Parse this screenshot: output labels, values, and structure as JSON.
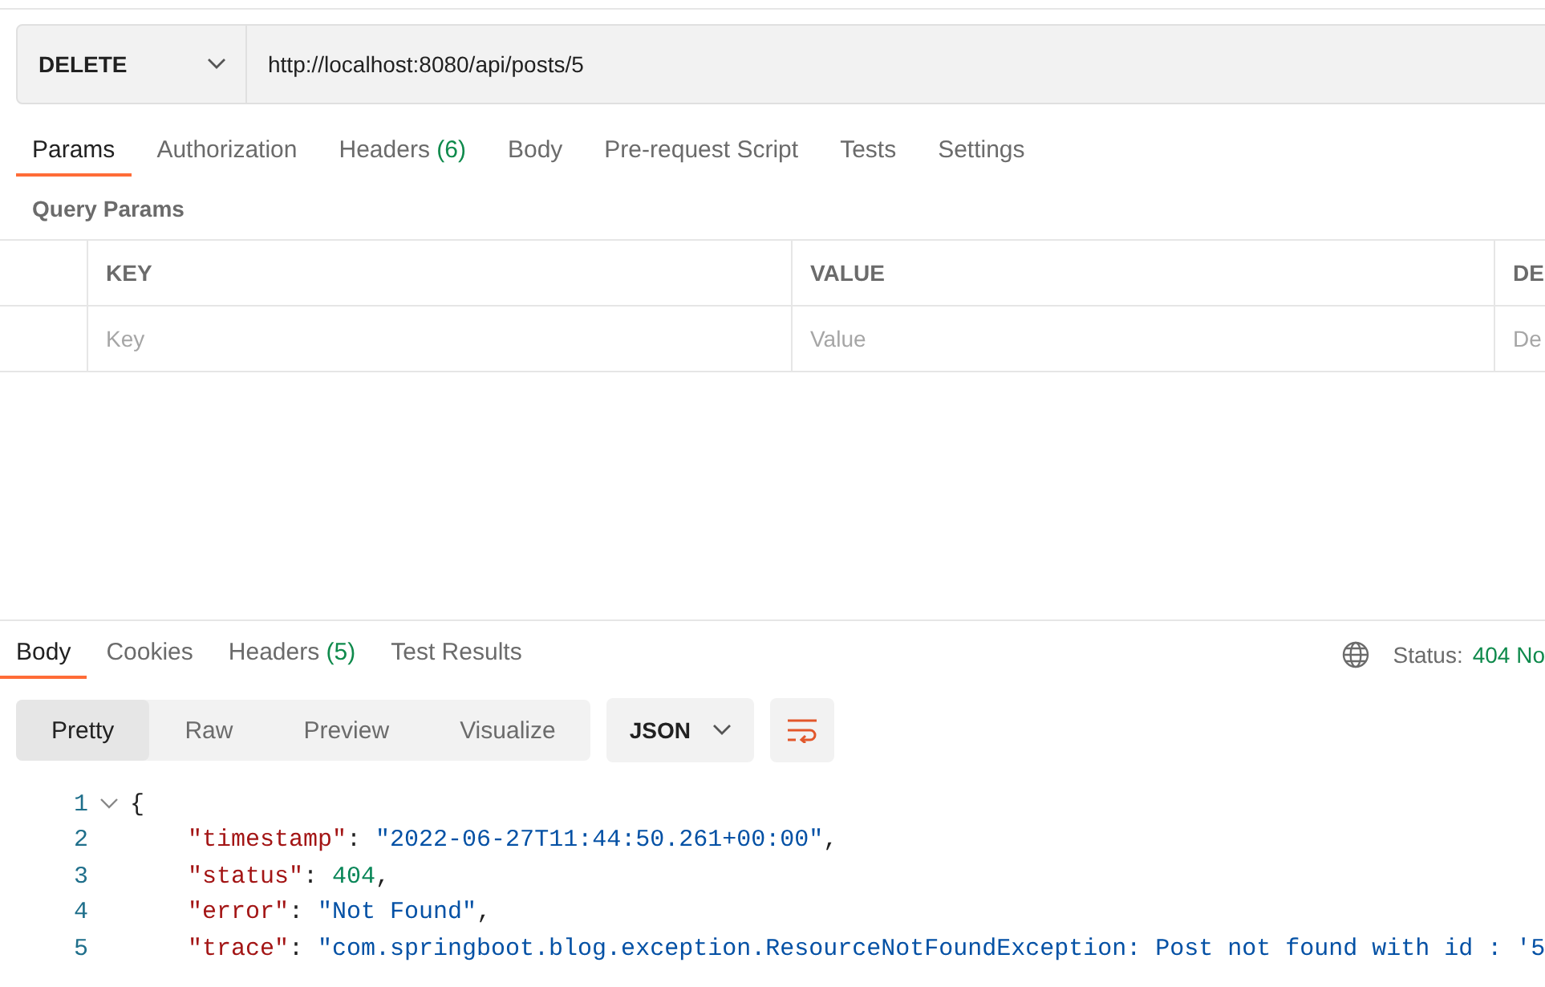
{
  "request": {
    "method": "DELETE",
    "url": "http://localhost:8080/api/posts/5"
  },
  "request_tabs": [
    {
      "label": "Params",
      "selected": true
    },
    {
      "label": "Authorization",
      "selected": false
    },
    {
      "label": "Headers",
      "count": "(6)",
      "selected": false
    },
    {
      "label": "Body",
      "selected": false
    },
    {
      "label": "Pre-request Script",
      "selected": false
    },
    {
      "label": "Tests",
      "selected": false
    },
    {
      "label": "Settings",
      "selected": false
    }
  ],
  "query_params": {
    "title": "Query Params",
    "columns": [
      "KEY",
      "VALUE",
      "DE"
    ],
    "placeholders": [
      "Key",
      "Value",
      "De"
    ]
  },
  "response_tabs": [
    {
      "label": "Body",
      "selected": true
    },
    {
      "label": "Cookies",
      "selected": false
    },
    {
      "label": "Headers",
      "count": "(5)",
      "selected": false
    },
    {
      "label": "Test Results",
      "selected": false
    }
  ],
  "status": {
    "label": "Status:",
    "value": "404 No"
  },
  "view_modes": [
    {
      "label": "Pretty",
      "selected": true
    },
    {
      "label": "Raw",
      "selected": false
    },
    {
      "label": "Preview",
      "selected": false
    },
    {
      "label": "Visualize",
      "selected": false
    }
  ],
  "format": "JSON",
  "code_lines": [
    {
      "number": "1",
      "foldable": true,
      "tokens": [
        {
          "kind": "punct",
          "text": "{"
        }
      ]
    },
    {
      "number": "2",
      "foldable": false,
      "tokens": [
        {
          "kind": "key",
          "text": "\"timestamp\""
        },
        {
          "kind": "punct",
          "text": ": "
        },
        {
          "kind": "string",
          "text": "\"2022-06-27T11:44:50.261+00:00\""
        },
        {
          "kind": "punct",
          "text": ","
        }
      ]
    },
    {
      "number": "3",
      "foldable": false,
      "tokens": [
        {
          "kind": "key",
          "text": "\"status\""
        },
        {
          "kind": "punct",
          "text": ": "
        },
        {
          "kind": "number",
          "text": "404"
        },
        {
          "kind": "punct",
          "text": ","
        }
      ]
    },
    {
      "number": "4",
      "foldable": false,
      "tokens": [
        {
          "kind": "key",
          "text": "\"error\""
        },
        {
          "kind": "punct",
          "text": ": "
        },
        {
          "kind": "string",
          "text": "\"Not Found\""
        },
        {
          "kind": "punct",
          "text": ","
        }
      ]
    },
    {
      "number": "5",
      "foldable": false,
      "tokens": [
        {
          "kind": "key",
          "text": "\"trace\""
        },
        {
          "kind": "punct",
          "text": ": "
        },
        {
          "kind": "string",
          "text": "\"com.springboot.blog.exception.ResourceNotFoundException: Post not found with id : '5"
        }
      ]
    }
  ]
}
